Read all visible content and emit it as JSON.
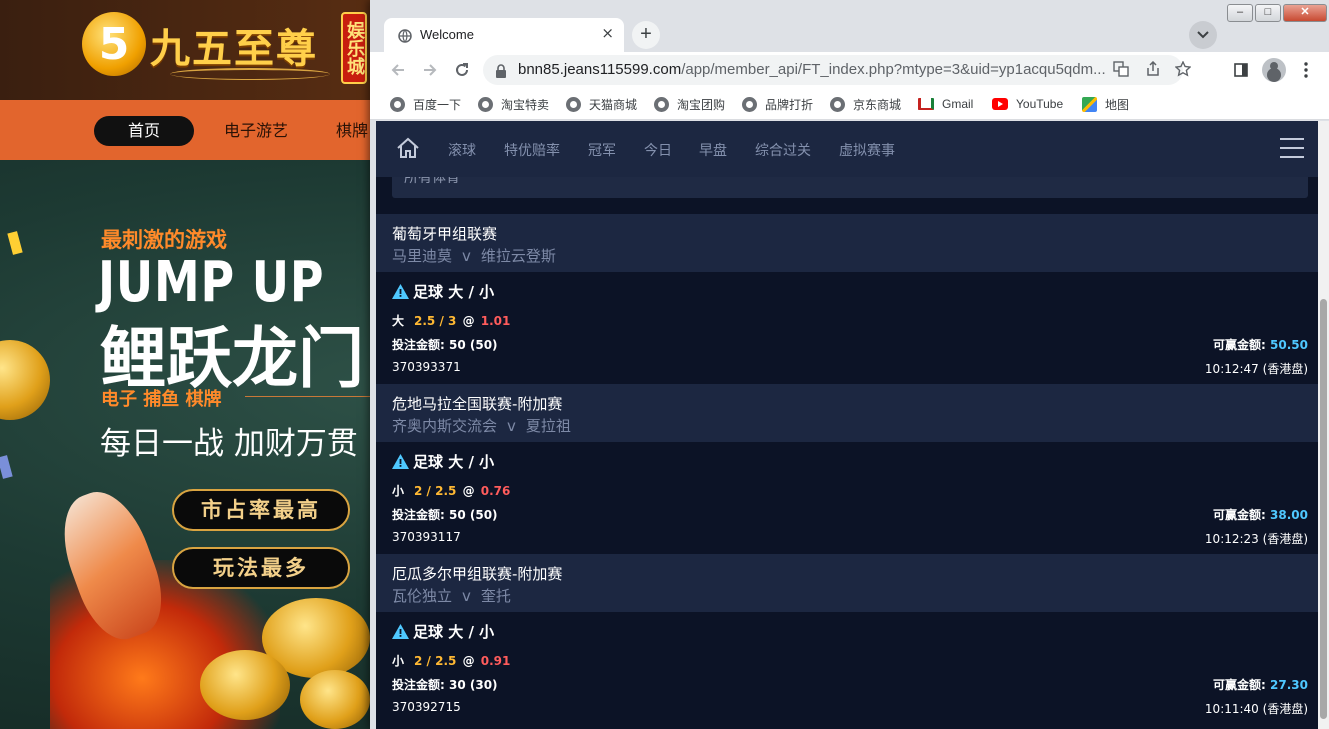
{
  "background_site": {
    "logo_glyph": "5",
    "logo_text": "九五至尊",
    "logo_badge": "娱乐城",
    "nav": [
      "首页",
      "电子游艺",
      "棋牌"
    ],
    "hero": {
      "subtitle": "最刺激的游戏",
      "jump": "JUMP UP",
      "headline": "鲤跃龙门",
      "categories": "电子  捕鱼  棋牌",
      "slogan": "每日一战  加财万贯",
      "button1": "市占率最高",
      "button2": "玩法最多"
    }
  },
  "browser": {
    "tab_title": "Welcome",
    "tab_close": "×",
    "new_tab": "+",
    "window_controls": [
      "–",
      "□",
      "✕"
    ],
    "url_host": "bnn85.jeans115599.com",
    "url_path": "/app/member_api/FT_index.php?mtype=3&uid=yp1acqu5qdm...",
    "bookmarks": [
      {
        "label": "百度一下",
        "icon": "globe-icon"
      },
      {
        "label": "淘宝特卖",
        "icon": "globe-icon"
      },
      {
        "label": "天猫商城",
        "icon": "globe-icon"
      },
      {
        "label": "淘宝团购",
        "icon": "globe-icon"
      },
      {
        "label": "品牌打折",
        "icon": "globe-icon"
      },
      {
        "label": "京东商城",
        "icon": "globe-icon"
      },
      {
        "label": "Gmail",
        "icon": "gmail-icon"
      },
      {
        "label": "YouTube",
        "icon": "youtube-icon"
      },
      {
        "label": "地图",
        "icon": "maps-icon"
      }
    ]
  },
  "app": {
    "nav": [
      "滚球",
      "特优赔率",
      "冠军",
      "今日",
      "早盘",
      "综合过关",
      "虚拟赛事"
    ],
    "filter_text": "所有体育",
    "labels": {
      "stake": "投注金额",
      "win": "可赢金额"
    },
    "bets": [
      {
        "league": "葡萄牙甲组联赛",
        "home": "马里迪莫",
        "vs": "v",
        "away": "维拉云登斯",
        "bet_type": "足球 大 / 小",
        "selection": "大",
        "handicap": "2.5 / 3",
        "at": "@",
        "odds": "1.01",
        "stake": "50 (50)",
        "win": "50.50",
        "ticket": "370393371",
        "time": "10:12:47 (香港盘)"
      },
      {
        "league": "危地马拉全国联赛-附加赛",
        "home": "齐奥内斯交流会",
        "vs": "v",
        "away": "夏拉祖",
        "bet_type": "足球 大 / 小",
        "selection": "小",
        "handicap": "2 / 2.5",
        "at": "@",
        "odds": "0.76",
        "stake": "50 (50)",
        "win": "38.00",
        "ticket": "370393117",
        "time": "10:12:23 (香港盘)"
      },
      {
        "league": "厄瓜多尔甲组联赛-附加赛",
        "home": "瓦伦独立",
        "vs": "v",
        "away": "奎托",
        "bet_type": "足球 大 / 小",
        "selection": "小",
        "handicap": "2 / 2.5",
        "at": "@",
        "odds": "0.91",
        "stake": "30 (30)",
        "win": "27.30",
        "ticket": "370392715",
        "time": "10:11:40 (香港盘)"
      }
    ]
  }
}
